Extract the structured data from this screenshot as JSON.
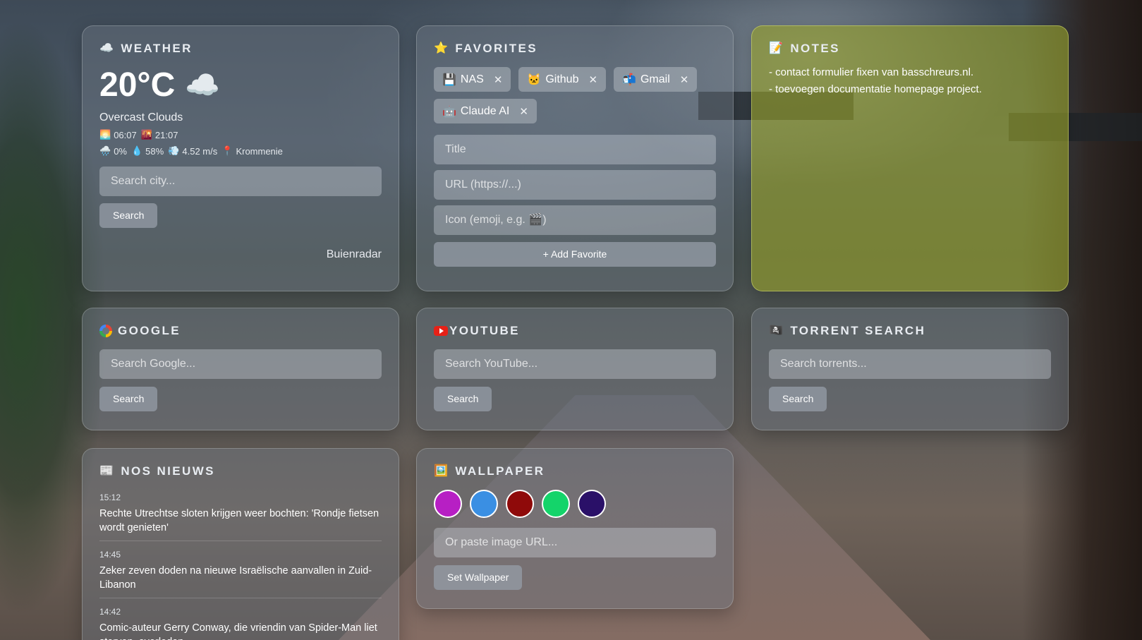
{
  "weather": {
    "title": "WEATHER",
    "temperature": "20°C",
    "condition_icon": "cloud-icon",
    "description": "Overcast Clouds",
    "sunrise": "06:07",
    "sunset": "21:07",
    "precipitation": "0%",
    "humidity": "58%",
    "wind": "4.52 m/s",
    "location": "Krommenie",
    "search_placeholder": "Search city...",
    "search_label": "Search",
    "source": "Buienradar"
  },
  "favorites": {
    "title": "FAVORITES",
    "items": [
      {
        "icon": "💾",
        "label": "NAS"
      },
      {
        "icon": "🐱",
        "label": "Github"
      },
      {
        "icon": "📬",
        "label": "Gmail"
      },
      {
        "icon": "🤖",
        "label": "Claude AI"
      }
    ],
    "remove_glyph": "✕",
    "title_placeholder": "Title",
    "url_placeholder": "URL (https://...)",
    "icon_placeholder": "Icon (emoji, e.g. 🎬)",
    "add_label": "+ Add Favorite"
  },
  "notes": {
    "title": "NOTES",
    "lines": [
      "- contact formulier fixen van basschreurs.nl.",
      "- toevoegen documentatie homepage project."
    ]
  },
  "google": {
    "title": "GOOGLE",
    "placeholder": "Search Google...",
    "search_label": "Search"
  },
  "youtube": {
    "title": "YOUTUBE",
    "placeholder": "Search YouTube...",
    "search_label": "Search"
  },
  "torrent": {
    "title": "TORRENT SEARCH",
    "placeholder": "Search torrents...",
    "search_label": "Search"
  },
  "news": {
    "title": "NOS NIEUWS",
    "items": [
      {
        "time": "15:12",
        "headline": "Rechte Utrechtse sloten krijgen weer bochten: 'Rondje fietsen wordt genieten'"
      },
      {
        "time": "14:45",
        "headline": "Zeker zeven doden na nieuwe Israëlische aanvallen in Zuid-Libanon"
      },
      {
        "time": "14:42",
        "headline": "Comic-auteur Gerry Conway, die vriendin van Spider-Man liet sterven, overleden"
      }
    ]
  },
  "wallpaper": {
    "title": "WALLPAPER",
    "swatches": [
      "#b71fc4",
      "#3a8fe3",
      "#8f0a0a",
      "#14d46a",
      "#2a1068"
    ],
    "url_placeholder": "Or paste image URL...",
    "set_label": "Set Wallpaper"
  }
}
